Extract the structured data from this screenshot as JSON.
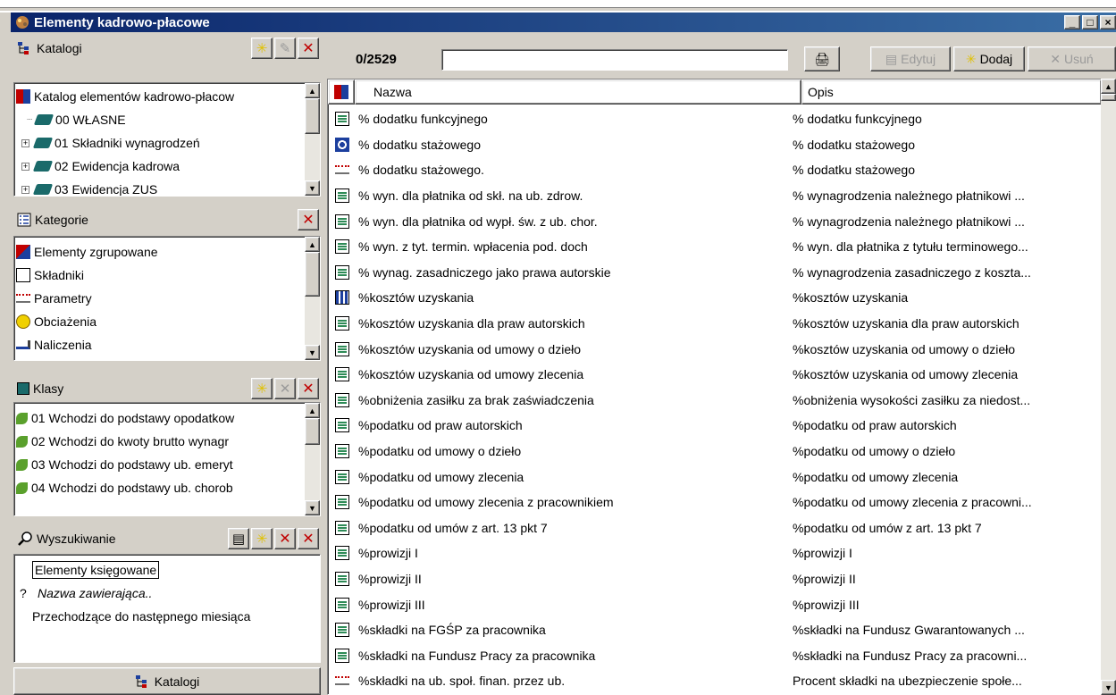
{
  "window": {
    "title": "Elementy kadrowo-płacowe",
    "buttons": [
      "_",
      "□",
      "×"
    ]
  },
  "left": {
    "catalogs": {
      "header": "Katalogi",
      "items": [
        {
          "label": "Katalog elementów kadrowo-płacow",
          "icon": "catalog-icon"
        },
        {
          "label": "00 WŁASNE",
          "icon": "book-icon"
        },
        {
          "label": "01 Składniki wynagrodzeń",
          "icon": "book-icon"
        },
        {
          "label": "02 Ewidencja kadrowa",
          "icon": "book-icon"
        },
        {
          "label": "03 Ewidencja ZUS",
          "icon": "book-icon"
        }
      ]
    },
    "categories": {
      "header": "Kategorie",
      "items": [
        {
          "label": "Elementy zgrupowane",
          "icon": "grouped-icon"
        },
        {
          "label": "Składniki",
          "icon": "component-icon"
        },
        {
          "label": "Parametry",
          "icon": "parameter-icon"
        },
        {
          "label": "Obciażenia",
          "icon": "charge-icon"
        },
        {
          "label": "Naliczenia",
          "icon": "accrual-icon"
        }
      ]
    },
    "classes": {
      "header": "Klasy",
      "items": [
        {
          "label": "01 Wchodzi do podstawy opodatkow"
        },
        {
          "label": "02 Wchodzi do kwoty brutto wynagr"
        },
        {
          "label": "03 Wchodzi do podstawy ub. emeryt"
        },
        {
          "label": "04 Wchodzi do podstawy ub. chorob"
        }
      ]
    },
    "search": {
      "header": "Wyszukiwanie",
      "items": [
        {
          "label": "Elementy księgowane"
        },
        {
          "label": "Nazwa zawierająca..",
          "prefix": "?"
        },
        {
          "label": "Przechodzące do następnego miesiąca"
        }
      ]
    },
    "footer_button": "Katalogi"
  },
  "toolbar": {
    "counter": "0/2529",
    "filter_value": "",
    "edit_label": "Edytuj",
    "add_label": "Dodaj",
    "delete_label": "Usuń"
  },
  "table": {
    "columns": {
      "name": "Nazwa",
      "desc": "Opis"
    },
    "rows": [
      {
        "name": "% dodatku funkcyjnego",
        "desc": "% dodatku funkcyjnego",
        "icon": "doc"
      },
      {
        "name": "% dodatku stażowego",
        "desc": "% dodatku stażowego",
        "icon": "target"
      },
      {
        "name": "% dodatku stażowego.",
        "desc": "% dodatku stażowego",
        "icon": "param"
      },
      {
        "name": "% wyn. dla płatnika od skł. na ub. zdrow.",
        "desc": "% wynagrodzenia należnego płatnikowi ...",
        "icon": "doc"
      },
      {
        "name": "% wyn. dla płatnika od wypł. św. z ub. chor.",
        "desc": "% wynagrodzenia należnego płatnikowi ...",
        "icon": "doc"
      },
      {
        "name": "% wyn. z tyt. termin. wpłacenia pod. doch",
        "desc": "% wyn. dla płatnika z tytułu terminowego...",
        "icon": "doc"
      },
      {
        "name": "% wynag. zasadniczego jako prawa autorskie",
        "desc": "% wynagrodzenia zasadniczego z koszta...",
        "icon": "doc"
      },
      {
        "name": "%kosztów uzyskania",
        "desc": "%kosztów uzyskania",
        "icon": "table"
      },
      {
        "name": "%kosztów uzyskania dla praw autorskich",
        "desc": "%kosztów uzyskania dla praw autorskich",
        "icon": "doc"
      },
      {
        "name": "%kosztów uzyskania od umowy o dzieło",
        "desc": "%kosztów uzyskania od umowy o dzieło",
        "icon": "doc"
      },
      {
        "name": "%kosztów uzyskania od umowy zlecenia",
        "desc": "%kosztów uzyskania od umowy zlecenia",
        "icon": "doc"
      },
      {
        "name": "%obniżenia zasiłku za brak zaświadczenia",
        "desc": "%obniżenia wysokości zasiłku za niedost...",
        "icon": "doc"
      },
      {
        "name": "%podatku od praw autorskich",
        "desc": "%podatku od praw autorskich",
        "icon": "doc"
      },
      {
        "name": "%podatku od umowy o dzieło",
        "desc": "%podatku od umowy o dzieło",
        "icon": "doc"
      },
      {
        "name": "%podatku od umowy zlecenia",
        "desc": "%podatku od umowy zlecenia",
        "icon": "doc"
      },
      {
        "name": "%podatku od umowy zlecenia z pracownikiem",
        "desc": "%podatku od umowy zlecenia z pracowni...",
        "icon": "doc"
      },
      {
        "name": "%podatku od umów z art. 13 pkt 7",
        "desc": "%podatku od umów z art. 13 pkt 7",
        "icon": "doc"
      },
      {
        "name": "%prowizji I",
        "desc": "%prowizji I",
        "icon": "doc"
      },
      {
        "name": "%prowizji II",
        "desc": "%prowizji II",
        "icon": "doc"
      },
      {
        "name": "%prowizji III",
        "desc": "%prowizji III",
        "icon": "doc"
      },
      {
        "name": "%składki na FGŚP za pracownika",
        "desc": "%składki na Fundusz Gwarantowanych ...",
        "icon": "doc"
      },
      {
        "name": "%składki na Fundusz Pracy za pracownika",
        "desc": "%składki na Fundusz Pracy za pracowni...",
        "icon": "doc"
      },
      {
        "name": "%składki na ub. społ. finan. przez ub.",
        "desc": "Procent składki na ubezpieczenie społe...",
        "icon": "param"
      }
    ]
  }
}
